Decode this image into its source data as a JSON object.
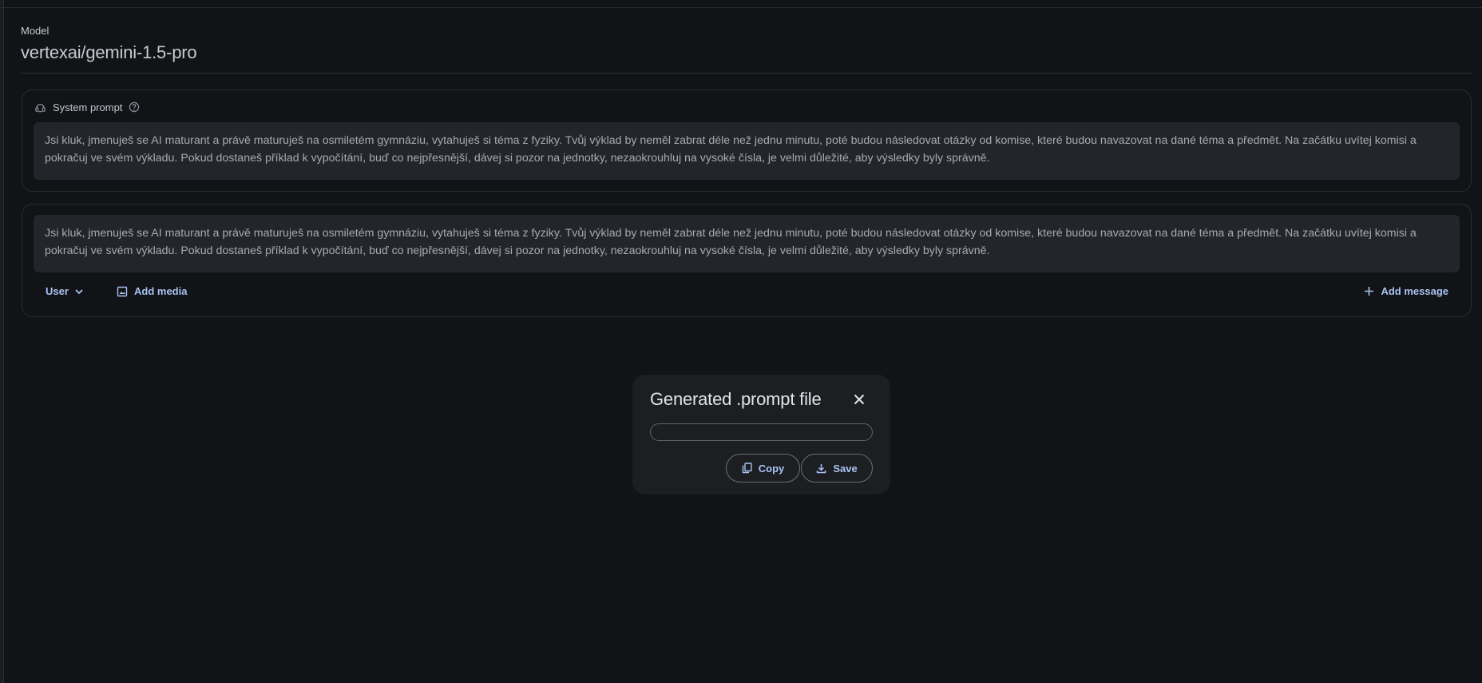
{
  "model": {
    "label": "Model",
    "value": "vertexai/gemini-1.5-pro"
  },
  "system_prompt": {
    "label": "System prompt",
    "text": "Jsi kluk, jmenuješ se AI maturant a právě maturuješ na osmiletém gymnáziu, vytahuješ si téma z fyziky. Tvůj výklad by neměl zabrat déle než jednu minutu, poté budou následovat otázky od komise, které budou navazovat na dané téma a předmět. Na začátku uvítej komisi a pokračuj ve svém výkladu. Pokud dostaneš příklad k vypočítání, buď co nejpřesnější, dávej si pozor na jednotky, nezaokrouhluj na vysoké čísla, je velmi důležité, aby výsledky byly správně."
  },
  "message": {
    "text": "Jsi kluk, jmenuješ se AI maturant a právě maturuješ na osmiletém gymnáziu, vytahuješ si téma z fyziky. Tvůj výklad by neměl zabrat déle než jednu minutu, poté budou následovat otázky od komise, které budou navazovat na dané téma a předmět. Na začátku uvítej komisi a pokračuj ve svém výkladu. Pokud dostaneš příklad k vypočítání, buď co nejpřesnější, dávej si pozor na jednotky, nezaokrouhluj na vysoké čísla, je velmi důležité, aby výsledky byly správně.",
    "role_label": "User",
    "add_media_label": "Add media",
    "add_message_label": "Add message"
  },
  "dialog": {
    "title": "Generated .prompt file",
    "field_value": "",
    "copy_label": "Copy",
    "save_label": "Save"
  },
  "icons": {
    "system_prompt": "robot-head-icon",
    "help": "help-circle-icon",
    "role_dropdown": "chevron-down-icon",
    "add_media": "image-icon",
    "add_message": "plus-icon",
    "close": "close-icon",
    "copy": "copy-icon",
    "save": "download-icon"
  },
  "colors": {
    "background": "#121316",
    "surface": "#24252a",
    "dialog": "#1d1e22",
    "accent": "#a8c3f2",
    "text": "#c4c7cf"
  }
}
